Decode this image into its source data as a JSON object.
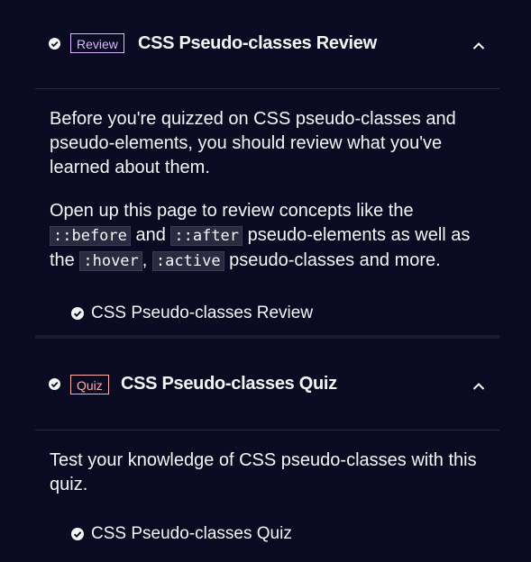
{
  "review_block": {
    "badge": "Review",
    "title": "CSS Pseudo-classes Review",
    "para1": "Before you're quizzed on CSS pseudo-classes and pseudo-elements, you should review what you've learned about them.",
    "para2_parts": {
      "a": "Open up this page to review concepts like the ",
      "code1": "::before",
      "b": " and ",
      "code2": "::after",
      "c": " pseudo-elements as well as the ",
      "code3": ":hover",
      "d": ", ",
      "code4": ":active",
      "e": " pseudo-classes and more."
    },
    "link_label": "CSS Pseudo-classes Review"
  },
  "quiz_block": {
    "badge": "Quiz",
    "title": "CSS Pseudo-classes Quiz",
    "para1": "Test your knowledge of CSS pseudo-classes with this quiz.",
    "link_label": "CSS Pseudo-classes Quiz"
  },
  "icons": {
    "completed": "check-circle-icon",
    "collapse": "chevron-up-icon"
  },
  "colors": {
    "background": "#0a0a23",
    "text": "#f5f6f7",
    "review_badge": "#dbb8ff",
    "quiz_badge": "#ffadad"
  }
}
